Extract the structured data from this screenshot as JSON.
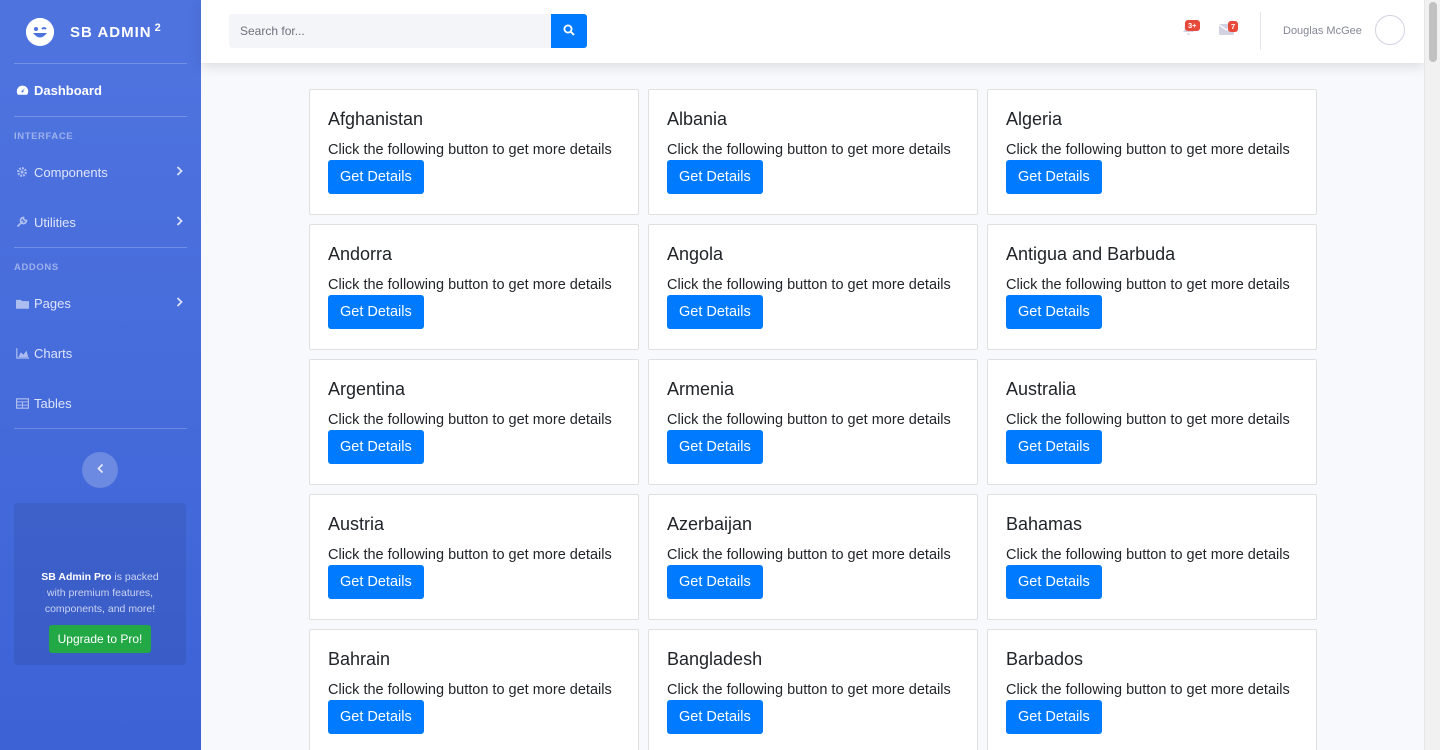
{
  "brand": {
    "name": "SB ADMIN",
    "sup": "2"
  },
  "sidebar": {
    "dashboard": "Dashboard",
    "heading_interface": "INTERFACE",
    "components": "Components",
    "utilities": "Utilities",
    "heading_addons": "ADDONS",
    "pages": "Pages",
    "charts": "Charts",
    "tables": "Tables",
    "promo_strong": "SB Admin Pro",
    "promo_text": " is packed with premium features, components, and more!",
    "promo_button": "Upgrade to Pro!"
  },
  "topbar": {
    "search_placeholder": "Search for...",
    "alerts_badge": "3+",
    "messages_badge": "7",
    "user_name": "Douglas McGee"
  },
  "cards": {
    "description": "Click the following button to get more details",
    "button_label": "Get Details",
    "items": [
      "Afghanistan",
      "Albania",
      "Algeria",
      "Andorra",
      "Angola",
      "Antigua and Barbuda",
      "Argentina",
      "Armenia",
      "Australia",
      "Austria",
      "Azerbaijan",
      "Bahamas",
      "Bahrain",
      "Bangladesh",
      "Barbados"
    ]
  },
  "colors": {
    "sidebar": "#4e73df",
    "primary": "#007bff",
    "badge": "#e74a3b",
    "success": "#22a845"
  }
}
